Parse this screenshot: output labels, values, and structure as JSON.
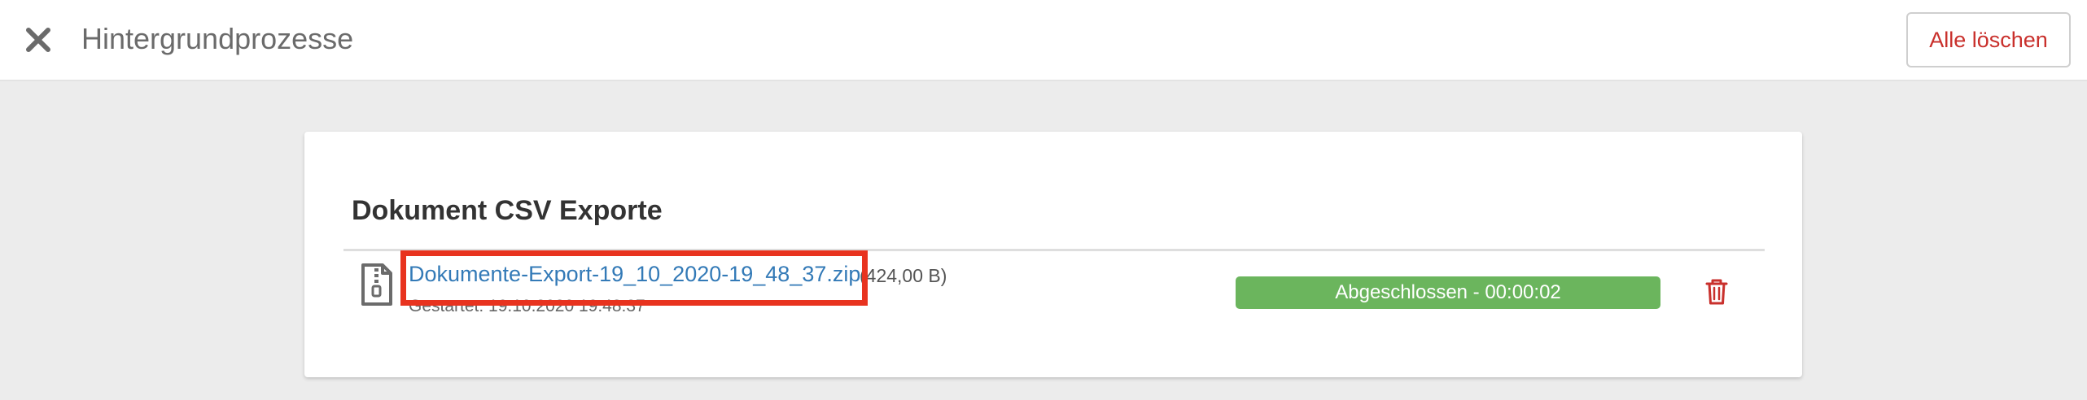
{
  "header": {
    "title": "Hintergrundprozesse",
    "close_icon": "close-icon",
    "delete_all_label": "Alle löschen"
  },
  "section": {
    "title": "Dokument CSV Exporte"
  },
  "export_item": {
    "file_icon": "zip-file-icon",
    "file_name": "Dokumente-Export-19_10_2020-19_48_37.zip",
    "file_size": "(424,00 B)",
    "started": "Gestartet: 19.10.2020 19:48:37",
    "status": "Abgeschlossen - 00:00:02",
    "progress_percent": 100,
    "delete_icon": "trash-icon"
  },
  "colors": {
    "accent_danger": "#c9302c",
    "link": "#337ab7",
    "status_success": "#6bb55d",
    "highlight": "#e8331f"
  }
}
